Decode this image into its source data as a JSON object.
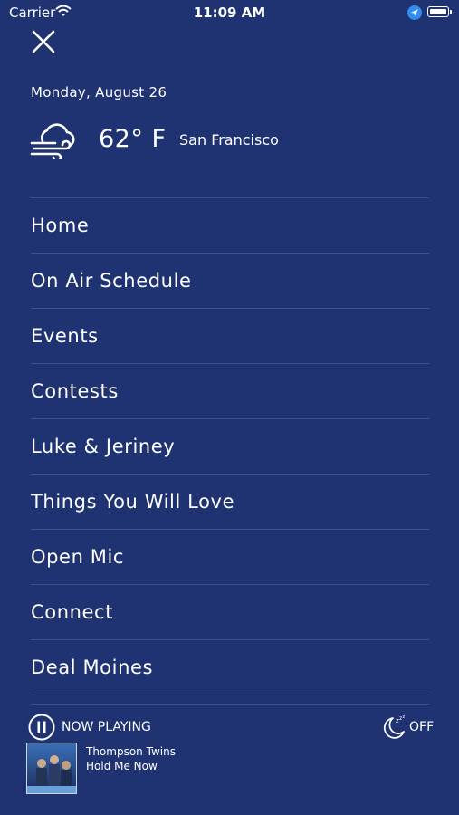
{
  "status_bar": {
    "carrier": "Carrier",
    "time": "11:09 AM"
  },
  "weather": {
    "date": "Monday, August 26",
    "temperature": "62° F",
    "city": "San Francisco",
    "icon": "wind-cloud-icon"
  },
  "menu": {
    "items": [
      {
        "label": "Home"
      },
      {
        "label": "On Air Schedule"
      },
      {
        "label": "Events"
      },
      {
        "label": "Contests"
      },
      {
        "label": "Luke & Jeriney"
      },
      {
        "label": "Things You Will Love"
      },
      {
        "label": "Open Mic"
      },
      {
        "label": "Connect"
      },
      {
        "label": "Deal Moines"
      }
    ]
  },
  "now_playing": {
    "label": "NOW PLAYING",
    "artist": "Thompson Twins",
    "track": "Hold Me Now",
    "sleep_timer": "OFF"
  },
  "colors": {
    "background": "#1f3372",
    "divider": "#3e538d",
    "text": "#ffffff"
  }
}
